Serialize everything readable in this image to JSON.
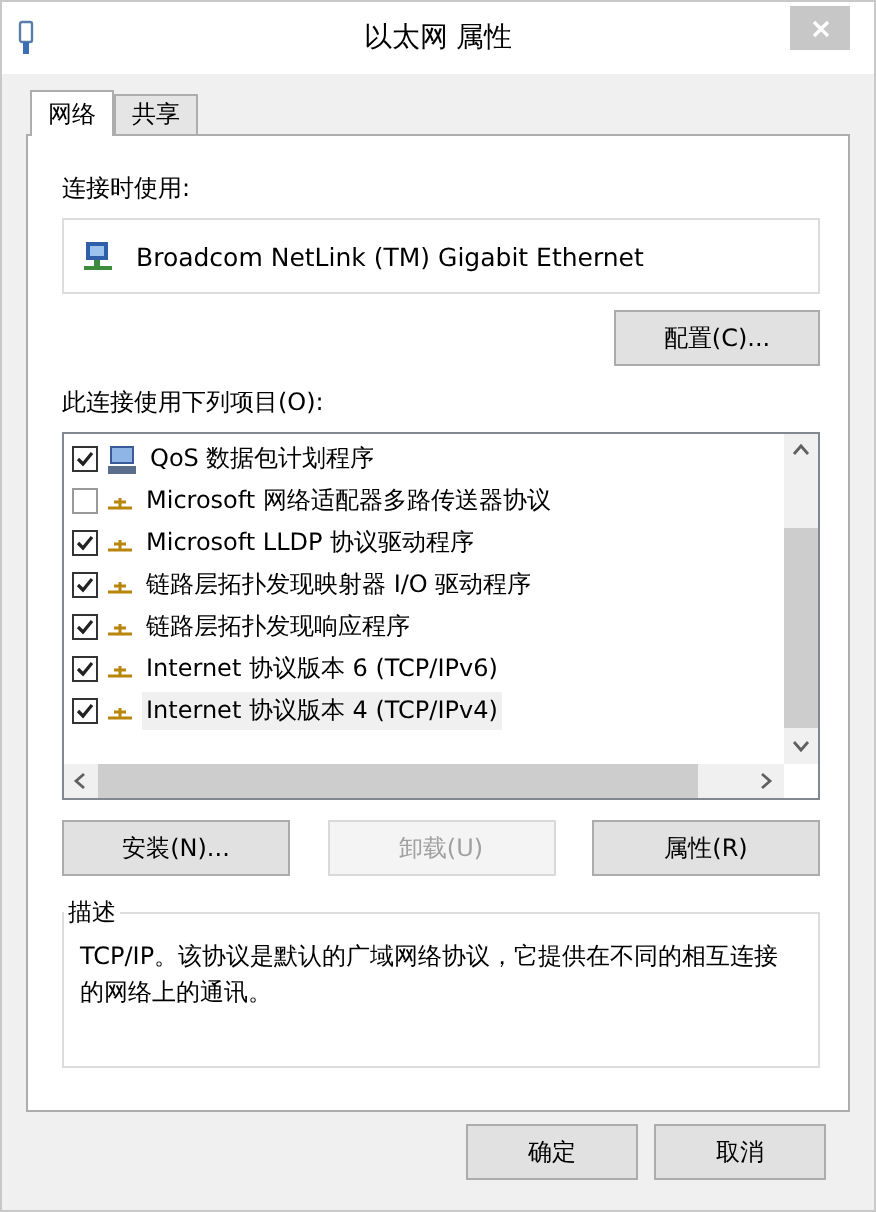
{
  "window": {
    "title": "以太网 属性"
  },
  "tabs": [
    {
      "label": "网络",
      "selected": true
    },
    {
      "label": "共享",
      "selected": false
    }
  ],
  "connect_using": {
    "label": "连接时使用:",
    "adapter": "Broadcom NetLink (TM) Gigabit Ethernet",
    "configure_button": "配置(C)..."
  },
  "items_label": "此连接使用下列项目(O):",
  "items": [
    {
      "kind": "service",
      "label": "QoS 数据包计划程序",
      "checked": true,
      "selected": false
    },
    {
      "kind": "protocol",
      "label": "Microsoft 网络适配器多路传送器协议",
      "checked": false,
      "selected": false
    },
    {
      "kind": "protocol",
      "label": "Microsoft LLDP 协议驱动程序",
      "checked": true,
      "selected": false
    },
    {
      "kind": "protocol",
      "label": "链路层拓扑发现映射器 I/O 驱动程序",
      "checked": true,
      "selected": false
    },
    {
      "kind": "protocol",
      "label": "链路层拓扑发现响应程序",
      "checked": true,
      "selected": false
    },
    {
      "kind": "protocol",
      "label": "Internet 协议版本 6 (TCP/IPv6)",
      "checked": true,
      "selected": false
    },
    {
      "kind": "protocol",
      "label": "Internet 协议版本 4 (TCP/IPv4)",
      "checked": true,
      "selected": true
    }
  ],
  "item_buttons": [
    {
      "label": "安装(N)...",
      "disabled": false
    },
    {
      "label": "卸载(U)",
      "disabled": true
    },
    {
      "label": "属性(R)",
      "disabled": false
    }
  ],
  "description": {
    "title": "描述",
    "text": "TCP/IP。该协议是默认的广域网络协议，它提供在不同的相互连接的网络上的通讯。"
  },
  "footer_buttons": [
    "确定",
    "取消"
  ]
}
